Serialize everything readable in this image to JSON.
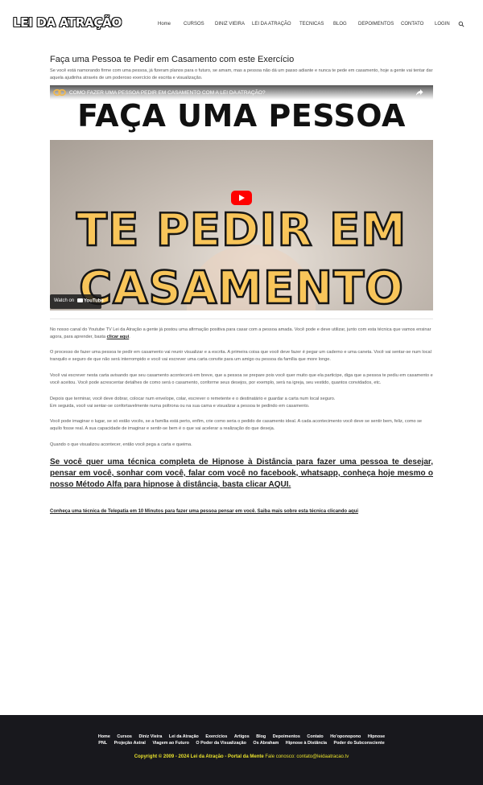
{
  "header": {
    "logo": "LEI DA ATRAÇÃO",
    "nav": [
      {
        "label": "Home",
        "id": "home"
      },
      {
        "label": "CURSOS",
        "id": "cursos"
      },
      {
        "label": "DINIZ VIEIRA",
        "id": "diniz-vieira"
      },
      {
        "label": "LEI DA ATRAÇÃO",
        "id": "lei-da-atracao"
      },
      {
        "label": "TECNICAS",
        "id": "tecnicas"
      },
      {
        "label": "BLOG",
        "id": "blog"
      },
      {
        "label": "DEPOIMENTOS",
        "id": "depoimentos"
      },
      {
        "label": "CONTATO",
        "id": "contato"
      },
      {
        "label": "LOGIN",
        "id": "login"
      }
    ],
    "search_icon": "search-icon"
  },
  "post": {
    "title": "Faça uma Pessoa te Pedir em Casamento com este Exercício",
    "intro": "Se você está namorando firme com uma pessoa, já fizeram planos para o futuro, se amam, mas a pessoa não dá um passo adiante e nunca te pede em casamento, hoje a gente vai tentar dar aquela ajudinha através de um poderoso exercício de escrita e visualização.",
    "video": {
      "bar_title": "COMO FAZER UMA PESSOA PEDIR EM CASAMENTO COM A LEI DA ATRAÇÃO?",
      "line1": "FAÇA UMA PESSOA",
      "line2": "TE PEDIR EM",
      "line3": "CASAMENTO",
      "watch_on": "Watch on",
      "youtube": "YouTube"
    },
    "p1_text": "No nosso canal do Youtube TV Lei da Atração a gente já postou uma afirmação positiva para casar com a pessoa amada. Você pode e deve utilizar, junto com esta técnica que vamos ensinar agora, para aprender, basta ",
    "p1_link": "clicar aqui",
    "p1_end": ".",
    "p2": "O processo de fazer uma pessoa te pedir em casamento vai reunir visualizar e a escrita. A primeira coisa que você deve fazer é pegar um caderno e uma caneta. Você vai sentar-se num local tranquilo e seguro de que não será interrompido e você vai escrever uma carta convite para um amigo ou pessoa da família que more longe.",
    "p3": "Você vai escrever nesta carta avisando que seu casamento acontecerá em breve, que a pessoa se prepare pois você quer muito que ela participe, diga que a pessoa te pediu em casamento e você aceitou. Você pode acrescentar detalhes de como será o casamento, conforme seus desejos, por exemplo, será na igreja, seu vestido, quantos convidados, etc.",
    "p4a": "Depois que terminar, você deve dobrar, colocar num envelope, colar, escrever o remetente e o destinatário e guardar a carta num local seguro.",
    "p4b": "Em seguida, você vai sentar-se confortavelmente numa poltrona ou na sua cama e visualizar a pessoa te pedindo em casamento.",
    "p5": "Você pode imaginar o lugar, se só estão vocês, se a família está perto, enfim, crie como seria o pedido de casamento ideal. A cada acontecimento você deve se sentir bem, feliz, como se aquilo fosse real. A sua capacidade de imaginar e sentir-se bem é o que vai acelerar a realização do que deseja.",
    "p6": "Quando o que visualizou acontecer, então você pega a carta e queima.",
    "cta": "Se você quer uma técnica completa de Hipnose à Distância para fazer uma pessoa te desejar, pensar em você, sonhar com você, falar com você no facebook, whatsapp, conheça hoje mesmo o nosso Método Alfa para hipnose à distância, basta clicar AQUI.",
    "cta2": "Conheça uma técnica de Telepatia em 10 Minutos para fazer uma pessoa pensar em você. Saiba mais sobre esta técnica clicando aqui"
  },
  "footer": {
    "row1": [
      "Home",
      "Cursos",
      "Diniz Vieira",
      "Lei da Atração",
      "Exercícios",
      "Artigos",
      "Blog",
      "Depoimentos",
      "Contato",
      "Ho'oponopono",
      "Hipnose"
    ],
    "row2": [
      "PNL",
      "Projeção Astral",
      "Viagem ao Futuro",
      "O Poder da Visualização",
      "Os Abraham",
      "Hipnose à Distância",
      "Poder do Subconsciente"
    ],
    "copyright": "Copyright © 2009 - 2024 Lei da Atração - Portal da Mente",
    "contact": " Fale conosco: contato@leidaatracao.tv"
  }
}
